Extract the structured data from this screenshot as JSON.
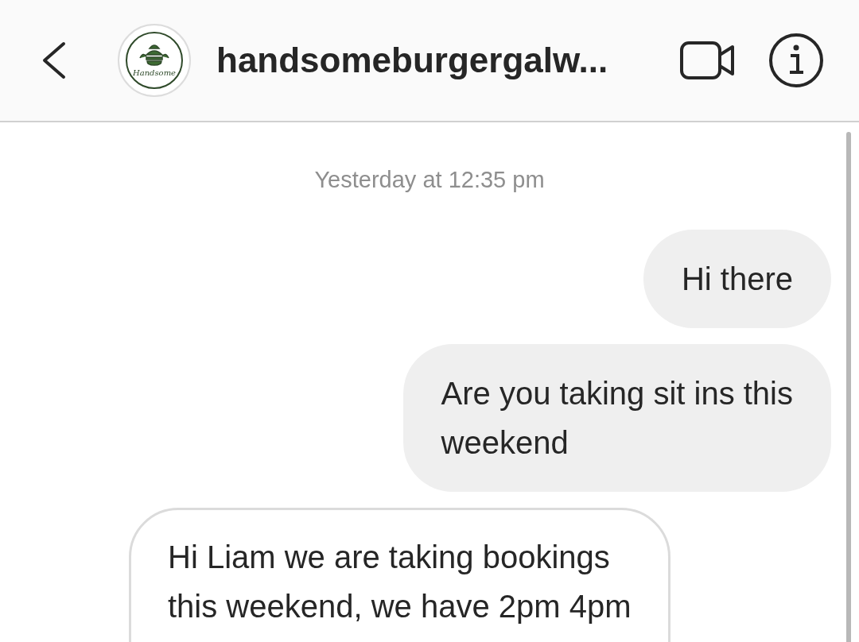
{
  "header": {
    "avatar": {
      "logo_text": "Handsome"
    },
    "title": "handsomeburgergalw..."
  },
  "timestamp": "Yesterday at 12:35 pm",
  "messages": [
    {
      "kind": "sent",
      "text": "Hi there"
    },
    {
      "kind": "sent",
      "text": "Are you taking sit ins this\nweekend"
    },
    {
      "kind": "received",
      "text": "Hi Liam we are taking bookings\nthis weekend, we have 2pm 4pm"
    }
  ]
}
